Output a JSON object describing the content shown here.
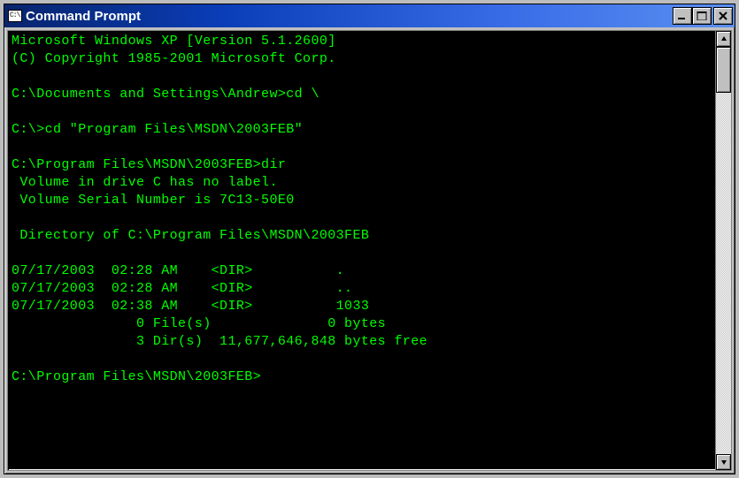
{
  "window": {
    "title": "Command Prompt",
    "iconText": "C:\\"
  },
  "console": {
    "lines": [
      "Microsoft Windows XP [Version 5.1.2600]",
      "(C) Copyright 1985-2001 Microsoft Corp.",
      "",
      "C:\\Documents and Settings\\Andrew>cd \\",
      "",
      "C:\\>cd \"Program Files\\MSDN\\2003FEB\"",
      "",
      "C:\\Program Files\\MSDN\\2003FEB>dir",
      " Volume in drive C has no label.",
      " Volume Serial Number is 7C13-50E0",
      "",
      " Directory of C:\\Program Files\\MSDN\\2003FEB",
      "",
      "07/17/2003  02:28 AM    <DIR>          .",
      "07/17/2003  02:28 AM    <DIR>          ..",
      "07/17/2003  02:38 AM    <DIR>          1033",
      "               0 File(s)              0 bytes",
      "               3 Dir(s)  11,677,646,848 bytes free",
      "",
      "C:\\Program Files\\MSDN\\2003FEB>"
    ]
  }
}
